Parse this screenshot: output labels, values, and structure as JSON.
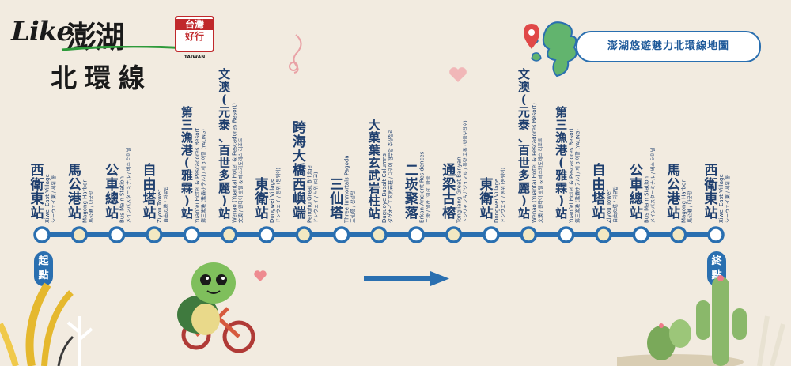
{
  "logo": {
    "like": "Like",
    "penghu": "澎湖",
    "badge_top": "台灣",
    "badge_mid": "好行",
    "badge_en": "TAIWAN"
  },
  "route_title": "北環線",
  "map_title": "澎湖悠遊魅力北環線地圖",
  "start_label": [
    "起",
    "點"
  ],
  "end_label": [
    "終",
    "點"
  ],
  "colors": {
    "blue": "#2a6fb0",
    "dot_light": "#f2e8c2",
    "dot_white": "#ffffff",
    "bg": "#f2ebe0"
  },
  "icons": [
    "music-note-icon",
    "heart-icon",
    "location-pin-icon",
    "turtle-on-bike-icon",
    "cactus-icon",
    "direction-arrow-icon"
  ],
  "stations": [
    {
      "zh": "西衛東站",
      "en": "Xiwei East Village",
      "sub": "シーウェイ東 / 서위 동"
    },
    {
      "zh": "馬公港站",
      "en": "Magong Harbor",
      "sub": "馬公港 / 마궁항"
    },
    {
      "zh": "公車總站",
      "en": "Bus Main Station",
      "sub": "メインバスターミナル / 버스 터미널"
    },
    {
      "zh": "自由塔站",
      "en": "Ziyou Tower",
      "sub": "自由の塔 / 자유탑"
    },
    {
      "zh": "第三漁港(雅霖)站",
      "en": "Yuanfei Hotel & Pescadores Resort",
      "sub": "第三漁港 (雅霖ホテル) / 제 3 어항 (YALING)"
    },
    {
      "zh": "文澳(元泰、百世多麗)站",
      "en": "Wenao (Yuantai Hotel & Pescadores Resort)",
      "sub": "文澳 / 원타이 호텔 & 페스카도레스 리조트"
    },
    {
      "zh": "東衛站",
      "en": "Dongwei Village",
      "sub": "ドンウェイ / 동위 (동웨이)"
    },
    {
      "zh": "跨海大橋西嶼端",
      "en": "Penghu Great Bridge",
      "sub": "ドンウェイ / 서위 (대교)"
    },
    {
      "zh": "三仙塔",
      "en": "Three Immortals Pagoda",
      "sub": "三仙塔 / 삼선탑"
    },
    {
      "zh": "大菓葉玄武岩柱站",
      "en": "Daguoye Basalt Columns",
      "sub": "ダグオイエ玄武岩柱 / 다궈예 현무암 주상절리"
    },
    {
      "zh": "二崁聚落",
      "en": "Erkan Ancient Residences",
      "sub": "二崁 / 얼칸 (이감) 마을"
    },
    {
      "zh": "通梁古榕",
      "en": "Tongliang Great Banyan",
      "sub": "トンリャン古ガジュマル / 통량 고목 (벵골보리수)"
    },
    {
      "zh": "東衛站",
      "en": "Dongwei Village",
      "sub": "ドンウェイ / 동위 (동웨이)"
    },
    {
      "zh": "文澳(元泰、百世多麗)站",
      "en": "Wenao (Yuantai Hotel & Pescadores Resort)",
      "sub": "文澳 / 원타이 호텔 & 페스카도레스 리조트"
    },
    {
      "zh": "第三漁港(雅霖)站",
      "en": "Yuanfei Hotel & Pescadores Resort",
      "sub": "第三漁港 (雅霖ホテル) / 제 3 어항 (YALING)"
    },
    {
      "zh": "自由塔站",
      "en": "Ziyou Tower",
      "sub": "自由の塔 / 자유탑"
    },
    {
      "zh": "公車總站",
      "en": "Bus Main Station",
      "sub": "メインバスターミナル / 버스 터미널"
    },
    {
      "zh": "馬公港站",
      "en": "Magong Harbor",
      "sub": "馬公港 / 마궁항"
    },
    {
      "zh": "西衛東站",
      "en": "Xiwei East Village",
      "sub": "シーウェイ東 / 서위 동"
    }
  ]
}
